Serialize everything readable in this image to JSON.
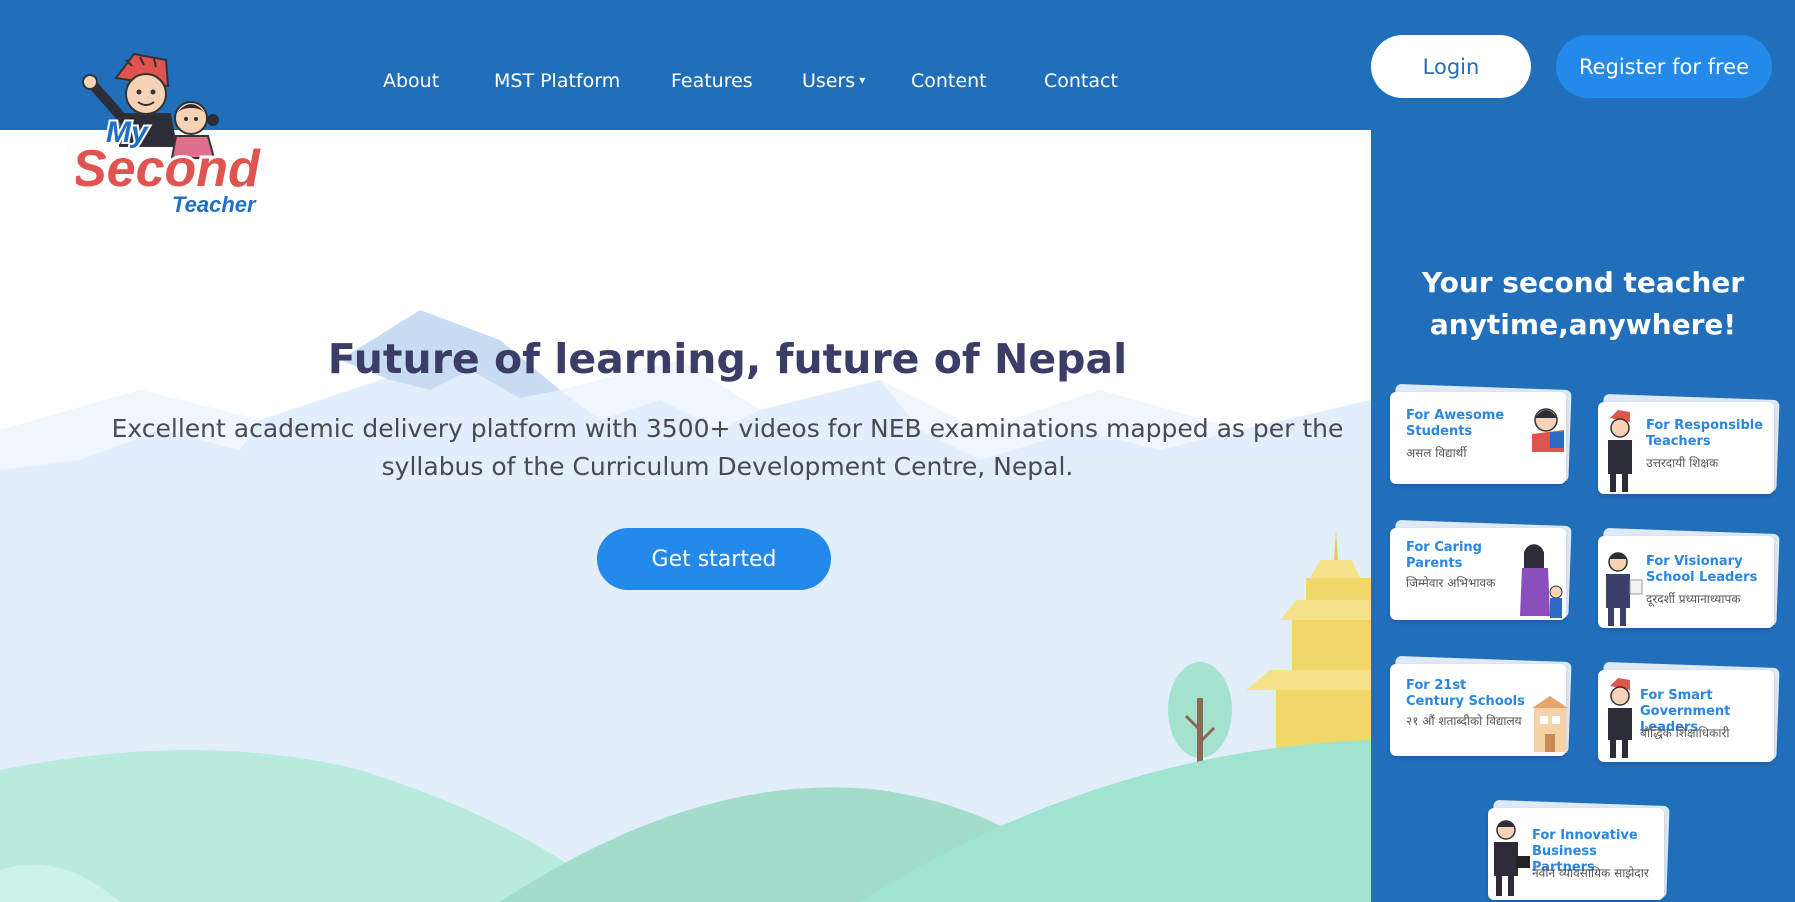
{
  "header": {
    "nav": [
      {
        "label": "About",
        "has_dropdown": false
      },
      {
        "label": "MST Platform",
        "has_dropdown": false
      },
      {
        "label": "Features",
        "has_dropdown": false
      },
      {
        "label": "Users",
        "has_dropdown": true
      },
      {
        "label": "Content",
        "has_dropdown": false
      },
      {
        "label": "Contact",
        "has_dropdown": false
      }
    ],
    "dropdown_caret": "▾",
    "login_label": "Login",
    "register_label": "Register for free"
  },
  "logo": {
    "word1": "My",
    "word2": "Second",
    "word3": "Teacher"
  },
  "hero": {
    "title": "Future of learning, future of Nepal",
    "subtitle": "Excellent academic delivery platform with 3500+ videos for NEB examinations mapped as per the syllabus of the Curriculum Development Centre, Nepal.",
    "cta_label": "Get started"
  },
  "panel": {
    "heading": "Your second teacher anytime,anywhere!",
    "cards": [
      {
        "en": "For Awesome Students",
        "np": "असल विद्यार्थी",
        "icon": "student-icon"
      },
      {
        "en": "For Responsible Teachers",
        "np": "उत्तरदायी शिक्षक",
        "icon": "teacher-icon"
      },
      {
        "en": "For Caring Parents",
        "np": "जिम्मेवार अभिभावक",
        "icon": "parent-icon"
      },
      {
        "en": "For Visionary School Leaders",
        "np": "दूरदर्शी प्रध्यानाध्यापक",
        "icon": "school-leader-icon"
      },
      {
        "en": "For 21st Century Schools",
        "np": "२१ औं शताब्दीको विद्यालय",
        "icon": "school-building-icon"
      },
      {
        "en": "For Smart Government Leaders",
        "np": "बौद्धिक शिक्षाधिकारी",
        "icon": "government-leader-icon"
      },
      {
        "en": "For Innovative Business Partners",
        "np": "नवीन व्यावसायिक साझेदार",
        "icon": "business-partner-icon"
      }
    ]
  },
  "colors": {
    "header_blue": "#216ebb",
    "button_blue": "#2389ea",
    "title_navy": "#3c3d66",
    "logo_red": "#e0544f",
    "logo_blue": "#1f6fc2"
  }
}
